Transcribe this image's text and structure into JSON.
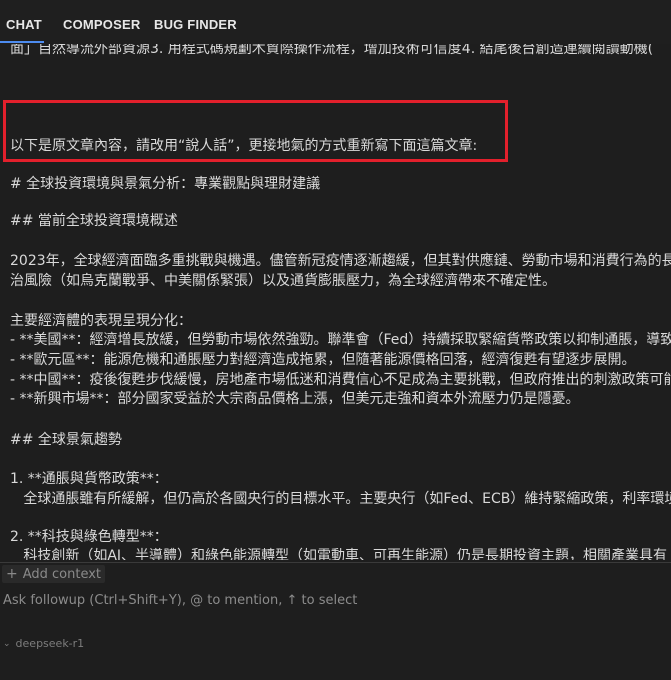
{
  "tabs": {
    "chat": "CHAT",
    "composer": "COMPOSER",
    "bug_finder": "BUG FINDER"
  },
  "content": {
    "line0": "面」自然導流外部資源3. 用程式碼規劃木貿際操作流程，增加技術可信度4. 結尾後台創造連續閱讀動機(",
    "prompt": "以下是原文章內容，請改用“說人話”，更接地氣的方式重新寫下面這篇文章:",
    "h1": "# 全球投資環境與景氣分析：專業觀點與理財建議",
    "h2": "## 當前全球投資環境概述",
    "p1a": "2023年，全球經濟面臨多重挑戰與機遇。儘管新冠疫情逐漸趨緩，但其對供應鏈、勞動市場和消費行為的長",
    "p1b": "治風險（如烏克蘭戰爭、中美關係緊張）以及通貨膨脹壓力，為全球經濟帶來不確定性。",
    "p2": "主要經濟體的表現呈現分化：",
    "b1": "- **美國**：經濟增長放緩，但勞動市場依然強勁。聯準會（Fed）持續採取緊縮貨幣政策以抑制通脹，導致",
    "b2": "- **歐元區**：能源危機和通脹壓力對經濟造成拖累，但隨著能源價格回落，經濟復甦有望逐步展開。",
    "b3": "- **中國**：疫後復甦步伐緩慢，房地產市場低迷和消費信心不足成為主要挑戰，但政府推出的刺激政策可能",
    "b4": "- **新興市場**：部分國家受益於大宗商品價格上漲，但美元走強和資本外流壓力仍是隱憂。",
    "h3": "## 全球景氣趨勢",
    "n1": "1. **通脹與貨幣政策**：",
    "n1a": "   全球通脹雖有所緩解，但仍高於各國央行的目標水平。主要央行（如Fed、ECB）維持緊縮政策，利率環境",
    "n2": "2. **科技與綠色轉型**：",
    "n2a": "   科技創新（如AI、半導體）和綠色能源轉型（如電動車、可再生能源）仍是長期投資主題，相關產業具有"
  },
  "input": {
    "add_context": "Add context",
    "followup_placeholder": "Ask followup (Ctrl+Shift+Y), @ to mention, ↑ to select"
  },
  "model": {
    "name": "deepseek-r1"
  },
  "colors": {
    "highlight_border": "#e3202c",
    "tab_underline": "#4d8cf0",
    "background": "#1e1e1e"
  }
}
